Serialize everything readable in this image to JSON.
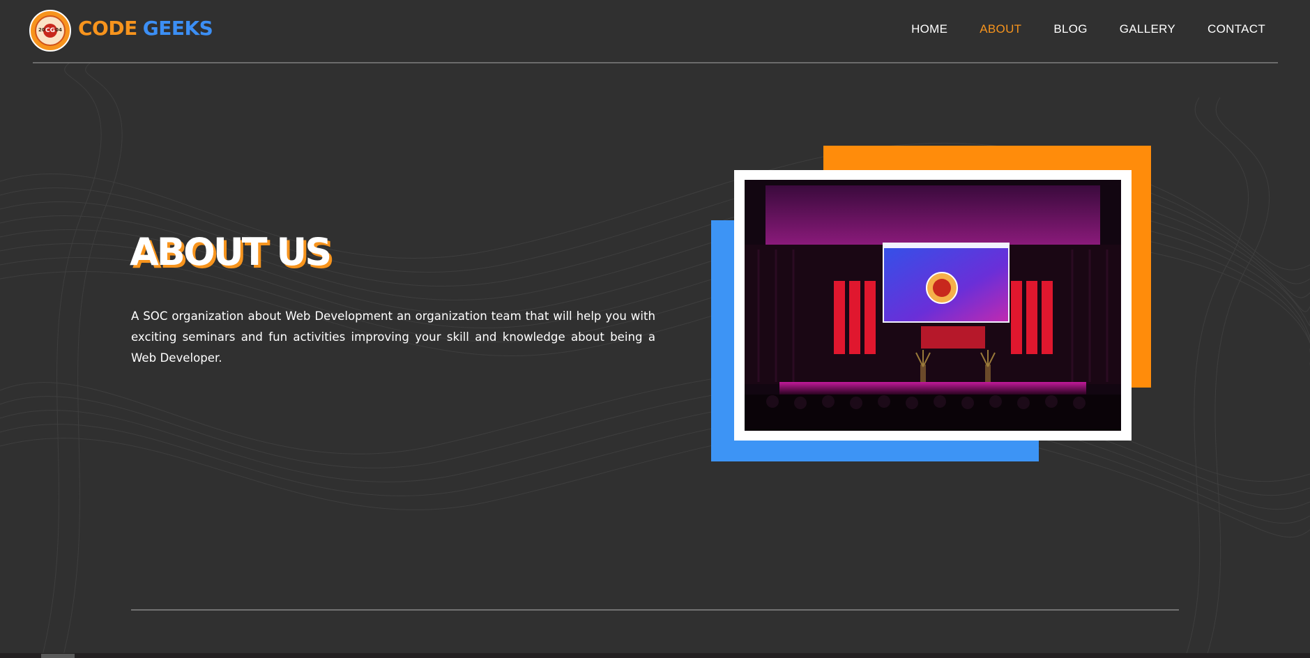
{
  "brand": {
    "logo_icon": "code-geeks-seal",
    "name_part1": "CODE",
    "name_part2": "GEEKS",
    "accent_orange": "#f7941d",
    "accent_blue": "#3c8ff5"
  },
  "nav": {
    "items": [
      {
        "label": "HOME",
        "active": false
      },
      {
        "label": "ABOUT",
        "active": true
      },
      {
        "label": "BLOG",
        "active": false
      },
      {
        "label": "GALLERY",
        "active": false
      },
      {
        "label": "CONTACT",
        "active": false
      }
    ]
  },
  "about": {
    "title": "ABOUT US",
    "description": "A SOC organization about Web Development an organization team that will help you with exciting seminars and fun activities improving your skill and knowledge about being a Web Developer."
  },
  "photo": {
    "subject": "stage-event-photo",
    "frame_colors": {
      "blue": "#3d94f5",
      "orange": "#ff8c0b",
      "border": "#ffffff"
    }
  },
  "background": {
    "color": "#303030"
  }
}
